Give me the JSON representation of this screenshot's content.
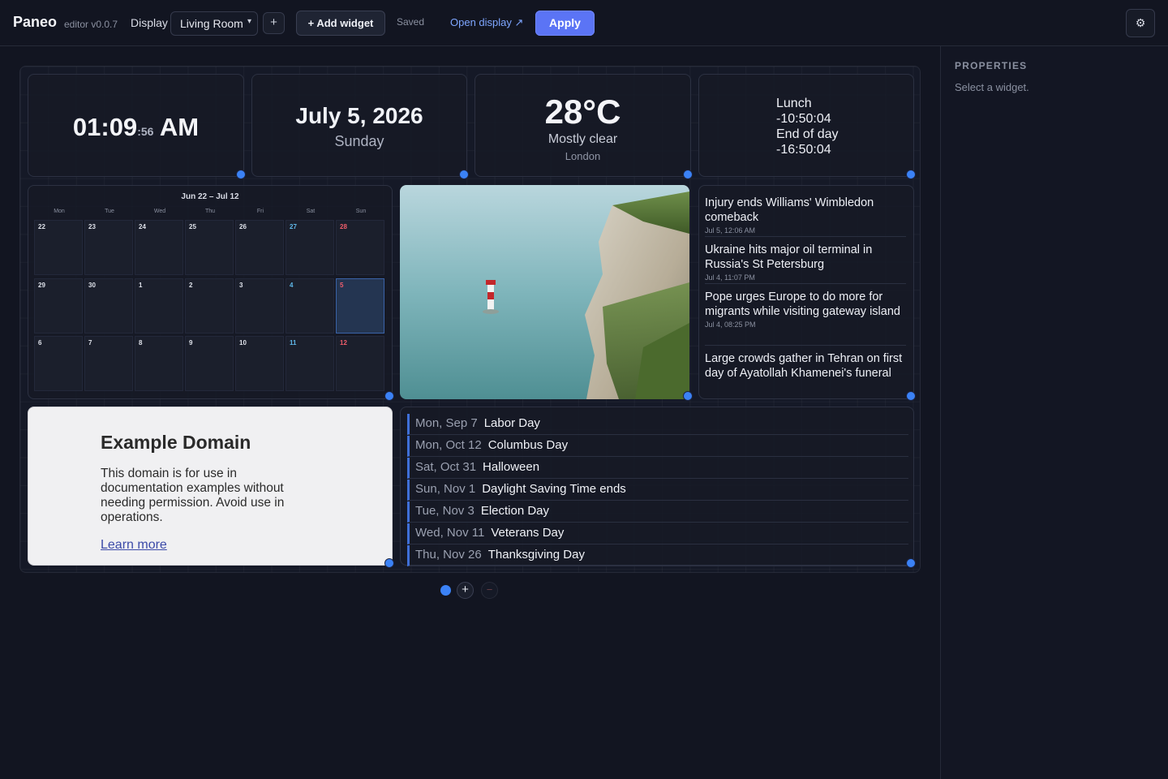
{
  "header": {
    "brand": "Paneo",
    "version": "editor v0.0.7",
    "display_label": "Display",
    "display_select": "Living Room",
    "add_display_symbol": "+",
    "add_widget_label": "+ Add widget",
    "save_status": "Saved",
    "open_display_label": "Open display ↗",
    "apply_label": "Apply",
    "settings_icon": "⚙"
  },
  "properties": {
    "title": "PROPERTIES",
    "hint": "Select a widget."
  },
  "clock": {
    "hours_minutes": "01:09",
    "seconds": ":56",
    "ampm": "AM"
  },
  "date": {
    "main": "July 5, 2026",
    "weekday": "Sunday"
  },
  "weather": {
    "temp": "28°C",
    "condition": "Mostly clear",
    "location": "London"
  },
  "countdown": {
    "lines": [
      "Lunch",
      "-10:50:04",
      "End of day",
      "-16:50:04"
    ]
  },
  "calendar": {
    "title": "Jun 22 – Jul 12",
    "weekdays": [
      "Mon",
      "Tue",
      "Wed",
      "Thu",
      "Fri",
      "Sat",
      "Sun"
    ],
    "weeks": [
      [
        "22",
        "23",
        "24",
        "25",
        "26",
        "27",
        "28"
      ],
      [
        "29",
        "30",
        "1",
        "2",
        "3",
        "4",
        "5"
      ],
      [
        "6",
        "7",
        "8",
        "9",
        "10",
        "11",
        "12"
      ]
    ],
    "today": "5"
  },
  "news": [
    {
      "title": "Injury ends Williams' Wimbledon comeback",
      "time": "Jul 5, 12:06 AM"
    },
    {
      "title": "Ukraine hits major oil terminal in Russia's St Petersburg",
      "time": "Jul 4, 11:07 PM"
    },
    {
      "title": "Pope urges Europe to do more for migrants while visiting gateway island",
      "time": "Jul 4, 08:25 PM"
    },
    {
      "title": "Large crowds gather in Tehran on first day of Ayatollah Khamenei's funeral",
      "time": ""
    }
  ],
  "web": {
    "heading": "Example Domain",
    "body": "This domain is for use in documentation examples without needing permission. Avoid use in operations.",
    "link": "Learn more"
  },
  "holidays": [
    {
      "date": "Mon, Sep 7",
      "name": "Labor Day"
    },
    {
      "date": "Mon, Oct 12",
      "name": "Columbus Day"
    },
    {
      "date": "Sat, Oct 31",
      "name": "Halloween"
    },
    {
      "date": "Sun, Nov 1",
      "name": "Daylight Saving Time ends"
    },
    {
      "date": "Tue, Nov 3",
      "name": "Election Day"
    },
    {
      "date": "Wed, Nov 11",
      "name": "Veterans Day"
    },
    {
      "date": "Thu, Nov 26",
      "name": "Thanksgiving Day"
    }
  ],
  "pager": {
    "add_symbol": "+",
    "remove_symbol": "−"
  },
  "colors": {
    "background": "#121521",
    "accent": "#5b74f5",
    "handle": "#3b82f6",
    "saturday": "#5fb7e8",
    "sunday": "#ef5d6b"
  }
}
